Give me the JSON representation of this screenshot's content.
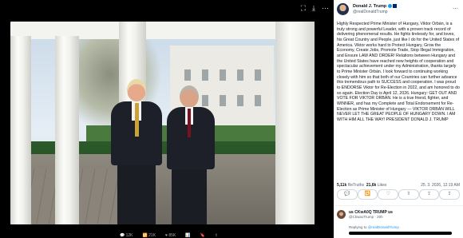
{
  "media": {
    "toolbar_icons": [
      "collapse-icon",
      "download-icon",
      "more-icon"
    ],
    "bottom_stats": [
      "💬 12K",
      "🔁 21K",
      "♥ 85K",
      "📊",
      "🔖",
      "⇧"
    ]
  },
  "post": {
    "author_name": "Donald J. Trump",
    "author_handle": "@realDonaldTrump",
    "text": "Highly Respected Prime Minister of Hungary, Viktor Orbán, is a truly strong and powerful Leader, with a proven track record of delivering phenomenal results. He fights tirelessly for, and loves, his Great Country and People, just like I do for the United States of America. Viktor works hard to Protect Hungary, Grow the Economy, Create Jobs, Promote Trade, Stop Illegal Immigration, and Ensure LAW AND ORDER! Relations between Hungary and the United States have reached new heights of cooperation and spectacular achievement under my Administration, thanks largely to Prime Minister Orbán. I look forward to continuing working closely with him so that both of our Countries can further advance this tremendous path to SUCCESS and cooperation. I was proud to ENDORSE Viktor for Re-Election in 2022, and am honored to do so again. Election Day is April 12, 2026. Hungary: GET OUT AND VOTE FOR VIKTOR ORBÁN. He is a true friend, fighter, and WINNER, and has my Complete and Total Endorsement for Re-Election as Prime Minister of Hungary — VIKTOR ORBÁN WILL NEVER LET THE GREAT PEOPLE OF HUNGARY DOWN. I AM WITH HIM ALL THE WAY! PRESIDENT DONALD J. TRUMP",
    "retruths_count": "5,11k",
    "retruths_label": "ReTruths",
    "likes_count": "21,6k",
    "likes_label": "Likes",
    "date": "25. 3. 2026, 12:19 AM"
  },
  "actions": [
    "💬",
    "🔁",
    "♡",
    "⇧",
    "⇪",
    "⇪"
  ],
  "reply": {
    "author_name": "us CKwA0Q TRUMP us",
    "author_handle": "@CkwaoTrump · 20h",
    "replying_prefix": "Replying to ",
    "replying_handle": "@realDonaldTrump"
  }
}
